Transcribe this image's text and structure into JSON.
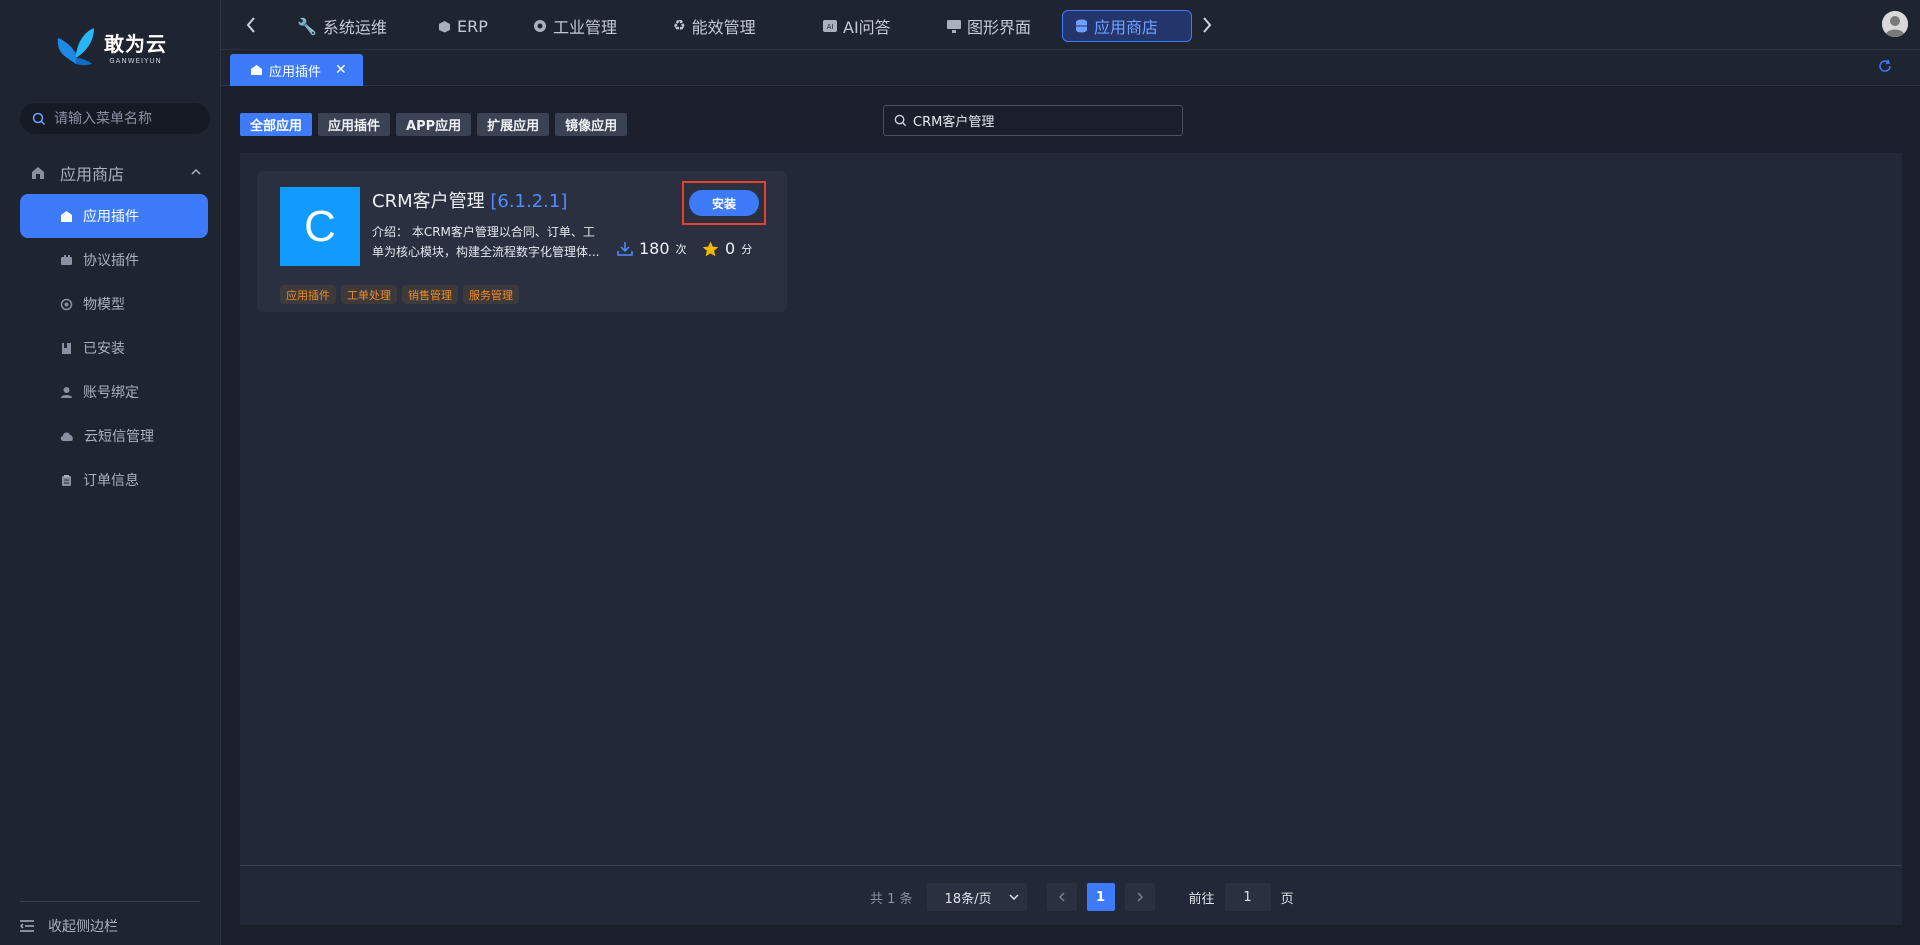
{
  "brand": {
    "name": "敢为云",
    "sub": "GANWEIYUN"
  },
  "sidebar": {
    "search_placeholder": "请输入菜单名称",
    "group_label": "应用商店",
    "items": [
      {
        "label": "应用插件",
        "icon": "store-icon",
        "active": true
      },
      {
        "label": "协议插件",
        "icon": "plugin-icon"
      },
      {
        "label": "物模型",
        "icon": "model-icon"
      },
      {
        "label": "已安装",
        "icon": "installed-icon"
      },
      {
        "label": "账号绑定",
        "icon": "user-icon"
      },
      {
        "label": "云短信管理",
        "icon": "cloud-icon"
      },
      {
        "label": "订单信息",
        "icon": "clipboard-icon"
      }
    ],
    "collapse_label": "收起侧边栏"
  },
  "topnav": {
    "items": [
      {
        "label": "系统运维",
        "icon": "wrench-icon"
      },
      {
        "label": "ERP",
        "icon": "cube-icon"
      },
      {
        "label": "工业管理",
        "icon": "gear-icon"
      },
      {
        "label": "能效管理",
        "icon": "recycle-icon"
      },
      {
        "label": "AI问答",
        "icon": "ai-icon"
      },
      {
        "label": "图形界面",
        "icon": "monitor-icon"
      },
      {
        "label": "应用商店",
        "icon": "database-icon",
        "active": true
      }
    ]
  },
  "tabs": [
    {
      "label": "应用插件",
      "icon": "store-icon"
    }
  ],
  "filters": [
    {
      "label": "全部应用",
      "active": true
    },
    {
      "label": "应用插件"
    },
    {
      "label": "APP应用"
    },
    {
      "label": "扩展应用"
    },
    {
      "label": "镜像应用"
    }
  ],
  "search": {
    "value": "CRM客户管理"
  },
  "apps": [
    {
      "icon_letter": "C",
      "icon_color": "#129bff",
      "name": "CRM客户管理",
      "version": "[6.1.2.1]",
      "desc": "介绍：  本CRM客户管理以合同、订单、工单为核心模块，构建全流程数字化管理体...",
      "install_label": "安装",
      "downloads": "180",
      "downloads_unit": "次",
      "score": "0",
      "score_unit": "分",
      "tags": [
        "应用插件",
        "工单处理",
        "销售管理",
        "服务管理"
      ]
    }
  ],
  "pagination": {
    "total": "共 1 条",
    "page_size": "18条/页",
    "current": "1",
    "goto_label": "前往",
    "goto_value": "1",
    "page_label": "页"
  },
  "colors": {
    "accent": "#3d7bfa",
    "tag": "#f08a24",
    "highlight": "#e5432d"
  }
}
